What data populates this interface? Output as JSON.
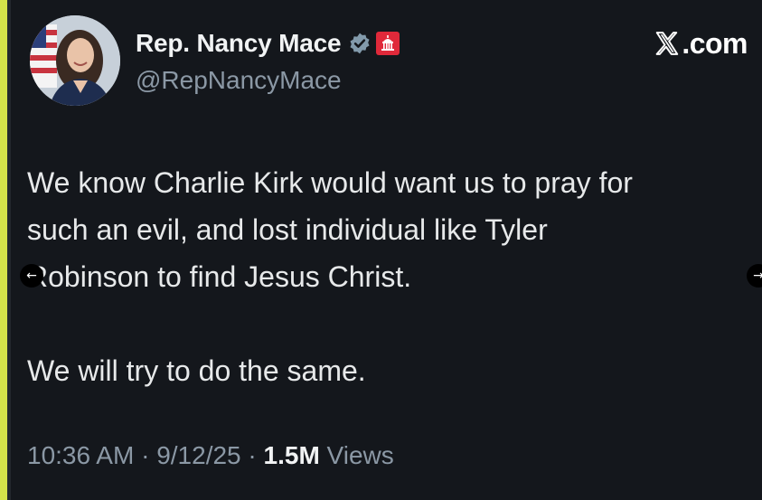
{
  "author": {
    "display_name": "Rep. Nancy Mace",
    "handle": "@RepNancyMace",
    "verified_icon": "verified-badge-icon",
    "affiliate_icon": "government-capitol-badge-icon"
  },
  "site": {
    "logo_icon": "x-logo-icon",
    "domain": ".com"
  },
  "tweet": {
    "lines": [
      "We know Charlie Kirk would want us to pray for",
      "such an evil, and lost individual like Tyler",
      "Robinson to find Jesus Christ.",
      "We will try to do the same."
    ]
  },
  "meta": {
    "time": "10:36 AM",
    "separator": "·",
    "date": "9/12/25",
    "views_count": "1.5M",
    "views_label": "Views"
  },
  "navigation": {
    "prev_icon": "arrow-left-icon",
    "next_icon": "arrow-right-icon"
  },
  "colors": {
    "background": "#14171c",
    "text_primary": "#e7e9ea",
    "text_secondary": "#8b98a5",
    "verified_badge": "#829aab",
    "gov_badge": "#e0293a",
    "edge_accent": "#d4e24a"
  }
}
